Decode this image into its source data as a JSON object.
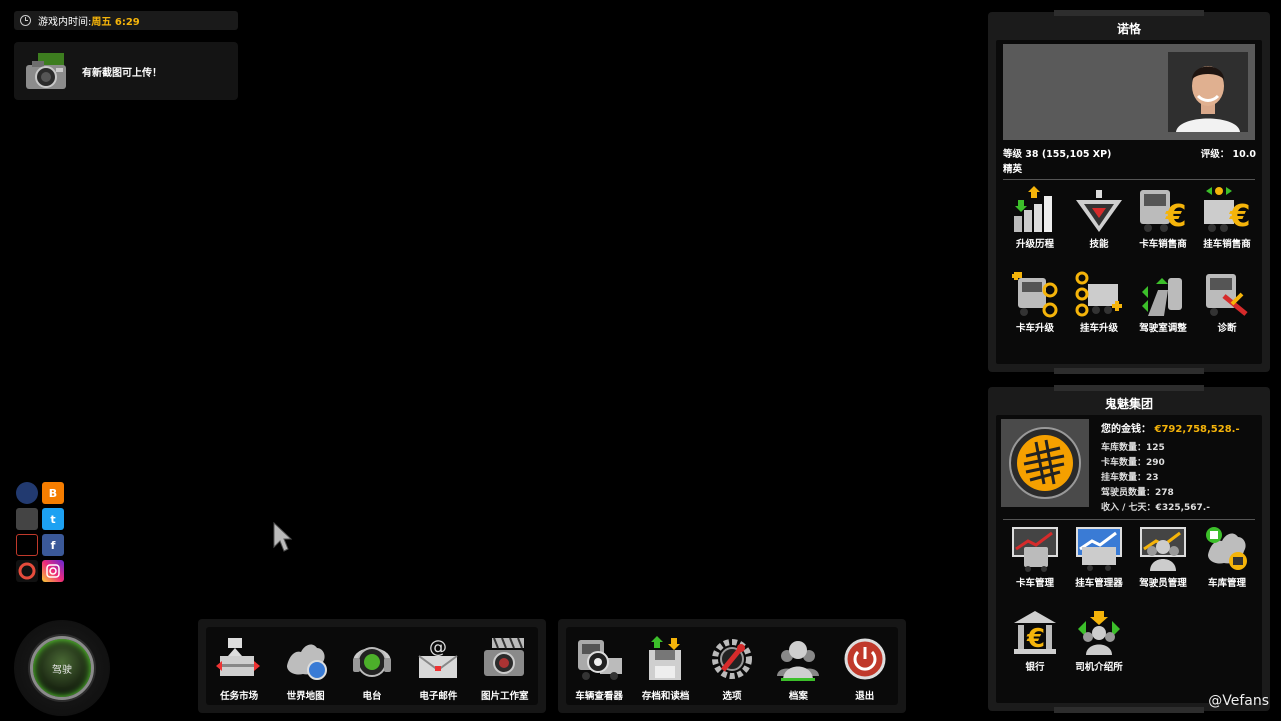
{
  "hud": {
    "time_label": "游戏内时间:",
    "time_value": "周五 6:29",
    "notice_text": "有新截图可上传！"
  },
  "drive": {
    "label": "驾驶"
  },
  "toolbar_left": [
    {
      "label": "任务市场",
      "icon": "job-market-icon"
    },
    {
      "label": "世界地图",
      "icon": "world-map-icon"
    },
    {
      "label": "电台",
      "icon": "radio-icon"
    },
    {
      "label": "电子邮件",
      "icon": "email-icon"
    },
    {
      "label": "图片工作室",
      "icon": "photo-studio-icon"
    }
  ],
  "toolbar_right": [
    {
      "label": "车辆查看器",
      "icon": "vehicle-browser-icon"
    },
    {
      "label": "存档和读档",
      "icon": "save-load-icon"
    },
    {
      "label": "选项",
      "icon": "options-gear-icon"
    },
    {
      "label": "档案",
      "icon": "profiles-icon"
    },
    {
      "label": "退出",
      "icon": "power-icon"
    }
  ],
  "profile": {
    "name": "诺恪",
    "level": "等级 38 (155,105 XP)",
    "rank": "精英",
    "rating_label": "评级：",
    "rating_value": "10.0",
    "items": [
      {
        "label": "升级历程",
        "icon": "upgrade-history-icon"
      },
      {
        "label": "技能",
        "icon": "skills-icon"
      },
      {
        "label": "卡车销售商",
        "icon": "truck-dealer-icon"
      },
      {
        "label": "挂车销售商",
        "icon": "trailer-dealer-icon"
      },
      {
        "label": "卡车升级",
        "icon": "truck-upgrade-icon"
      },
      {
        "label": "挂车升级",
        "icon": "trailer-upgrade-icon"
      },
      {
        "label": "驾驶室调整",
        "icon": "cabin-adjust-icon"
      },
      {
        "label": "诊断",
        "icon": "diagnostics-icon"
      }
    ]
  },
  "company": {
    "name": "鬼魅集团",
    "money_label": "您的金钱：",
    "money_value": "€792,758,528.-",
    "stats": [
      "车库数量：125",
      "卡车数量：290",
      "挂车数量：23",
      "驾驶员数量：278",
      "收入 / 七天：€325,567.-"
    ],
    "items": [
      {
        "label": "卡车管理",
        "icon": "truck-management-icon"
      },
      {
        "label": "挂车管理器",
        "icon": "trailer-management-icon"
      },
      {
        "label": "驾驶员管理",
        "icon": "driver-management-icon"
      },
      {
        "label": "车库管理",
        "icon": "garage-management-icon"
      },
      {
        "label": "银行",
        "icon": "bank-icon"
      },
      {
        "label": "司机介绍所",
        "icon": "recruitment-agency-icon"
      }
    ]
  },
  "watermark": "@Vefans",
  "colors": {
    "accent": "#f5b40a",
    "panel": "#1b1b1b",
    "inner": "#0a0a0a"
  }
}
